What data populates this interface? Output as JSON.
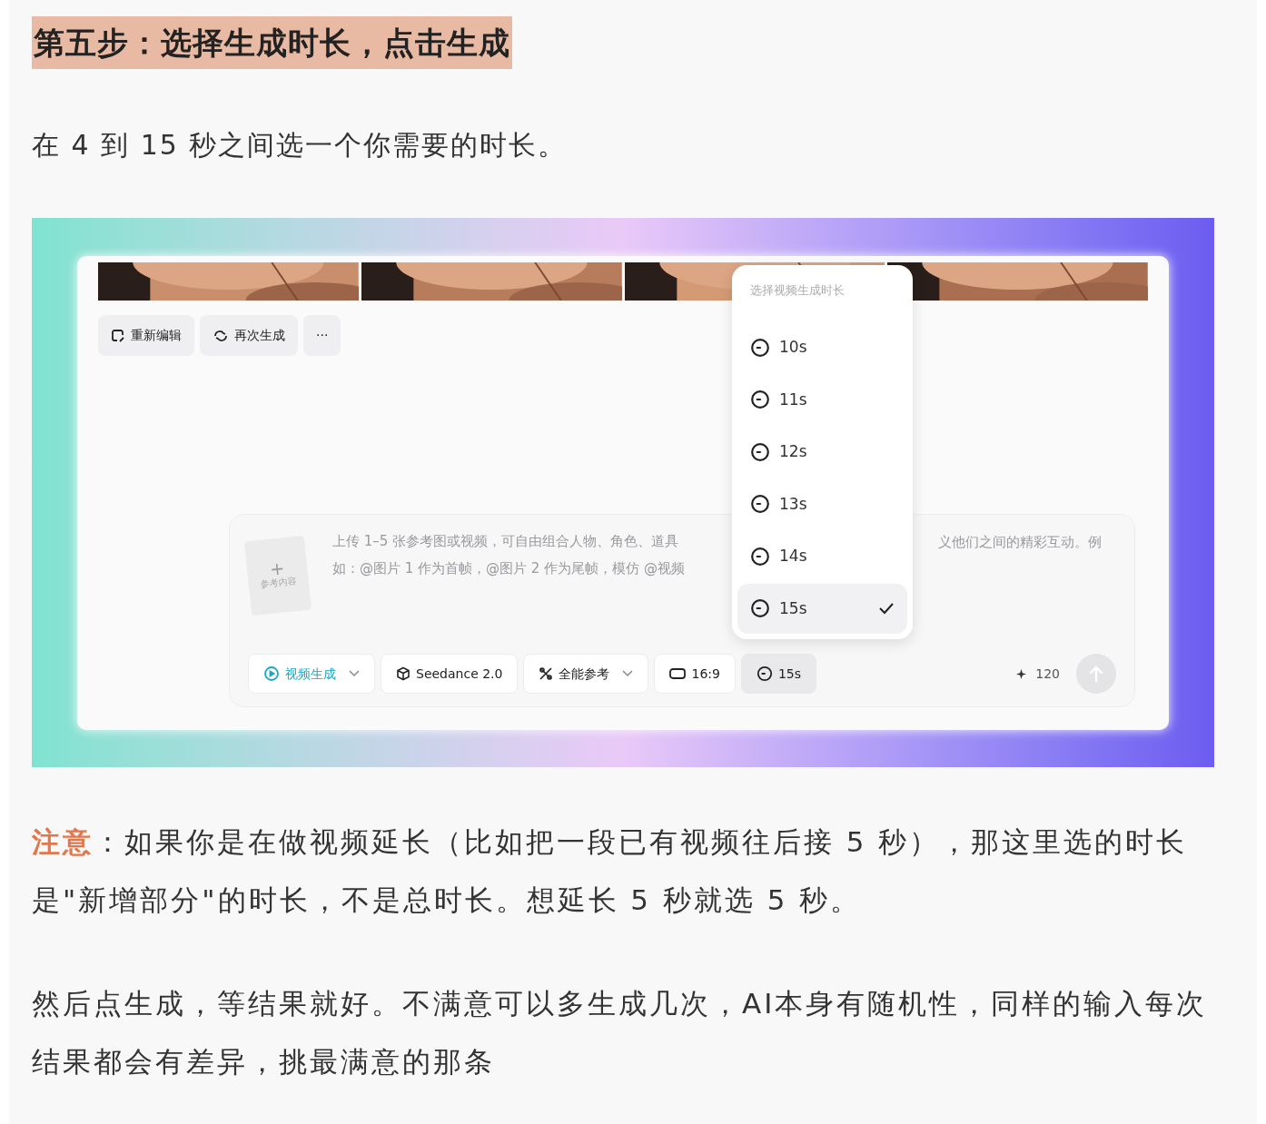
{
  "heading": "第五步：选择生成时长，点击生成",
  "intro": "在 4 到 15 秒之间选一个你需要的时长。",
  "screenshot": {
    "photos": [
      {
        "kind": "picture"
      },
      {
        "kind": "picture"
      },
      {
        "kind": "picture"
      },
      {
        "kind": "picture"
      }
    ],
    "actions": [
      {
        "kind": "edit",
        "label": "重新编辑"
      },
      {
        "kind": "regenerate",
        "label": "再次生成"
      },
      {
        "kind": "more",
        "label": "···"
      }
    ],
    "dropdown": {
      "title": "选择视频生成时长",
      "items": [
        {
          "label": "10s",
          "selected": false
        },
        {
          "label": "11s",
          "selected": false
        },
        {
          "label": "12s",
          "selected": false
        },
        {
          "label": "13s",
          "selected": false
        },
        {
          "label": "14s",
          "selected": false
        },
        {
          "label": "15s",
          "selected": true
        }
      ]
    },
    "reference_label": "参考内容",
    "prompt_left": [
      "上传 1–5 张参考图或视频，可自由组合人物、角色、道具",
      "如：@图片 1 作为首帧，@图片 2 作为尾帧，模仿 @视频"
    ],
    "prompt_right": "义他们之间的精彩互动。例",
    "toolbar": [
      {
        "kind": "mode",
        "label": "视频生成",
        "selected": false
      },
      {
        "kind": "model",
        "label": "Seedance 2.0",
        "selected": false
      },
      {
        "kind": "reference",
        "label": "全能参考",
        "selected": false
      },
      {
        "kind": "ratio",
        "label": "16:9",
        "selected": false
      },
      {
        "kind": "duration",
        "label": "15s",
        "selected": true
      }
    ],
    "credits": "120"
  },
  "note": {
    "label": "注意",
    "text": "：如果你是在做视频延长（比如把一段已有视频往后接 5 秒），那这里选的时长是\"新增部分\"的时长，不是总时长。想延长 5 秒就选 5 秒。"
  },
  "closing": "然后点生成，等结果就好。不满意可以多生成几次，AI本身有随机性，同样的输入每次结果都会有差异，挑最满意的那条"
}
